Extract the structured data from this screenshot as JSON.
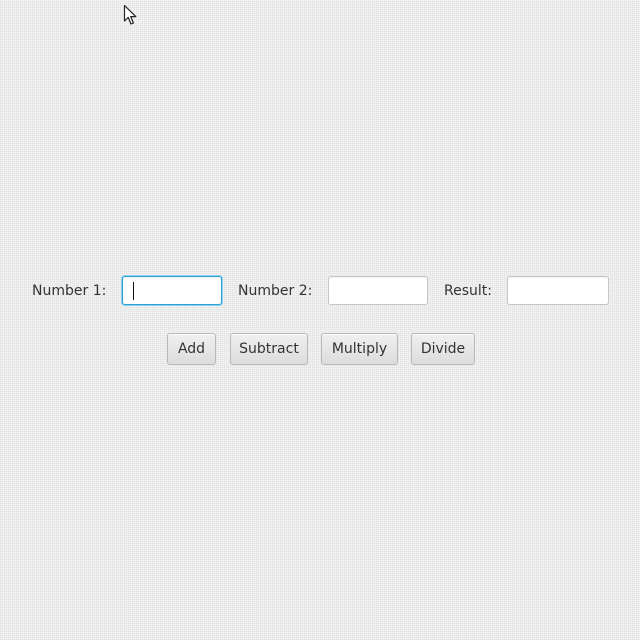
{
  "form": {
    "number1_label": "Number 1:",
    "number1_value": "",
    "number2_label": "Number 2:",
    "number2_value": "",
    "result_label": "Result:",
    "result_value": ""
  },
  "buttons": {
    "add": "Add",
    "subtract": "Subtract",
    "multiply": "Multiply",
    "divide": "Divide"
  },
  "cursor": {
    "icon": "arrow-pointer-icon"
  }
}
